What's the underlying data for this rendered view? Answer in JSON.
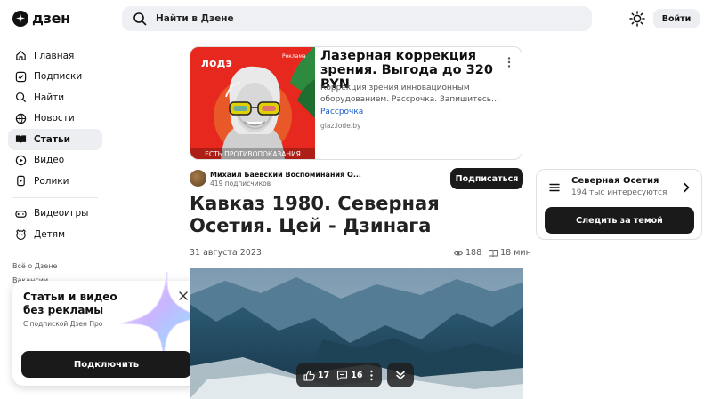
{
  "header": {
    "logo_text": "дзен",
    "search_label": "Найти в Дзене",
    "login_label": "Войти"
  },
  "sidebar": {
    "items": [
      {
        "label": "Главная",
        "icon": "home-icon"
      },
      {
        "label": "Подписки",
        "icon": "subscriptions-icon"
      },
      {
        "label": "Найти",
        "icon": "search-icon"
      },
      {
        "label": "Новости",
        "icon": "news-icon"
      },
      {
        "label": "Статьи",
        "icon": "articles-icon",
        "active": true
      },
      {
        "label": "Видео",
        "icon": "video-icon"
      },
      {
        "label": "Ролики",
        "icon": "clips-icon"
      }
    ],
    "extra_items": [
      {
        "label": "Видеоигры",
        "icon": "gamepad-icon"
      },
      {
        "label": "Детям",
        "icon": "kids-icon"
      }
    ],
    "footer_links": [
      "Всё о Дзене",
      "Вакансии"
    ]
  },
  "promo": {
    "title": "Статьи и видео без рекламы",
    "subtitle": "С подпиской Дзен Про",
    "button_label": "Подключить"
  },
  "ad": {
    "brand": "лодэ",
    "tag": "Реклама",
    "image_caption": "ЕСТЬ ПРОТИВОПОКАЗАНИЯ",
    "title": "Лазерная коррекция зрения. Выгода до 320 BYN",
    "description": "Коррекция зрения инновационным оборудованием. Рассрочка. Запишитесь...",
    "link_label": "Рассрочка",
    "domain": "glaz.lode.by"
  },
  "article": {
    "channel_name": "Михаил Баевский Воспоминания О...",
    "channel_subscribers": "419 подписчиков",
    "subscribe_label": "Подписаться",
    "title": "Кавказ 1980. Северная Осетия. Цей - Дзинага",
    "date": "31 августа 2023",
    "views": "188",
    "read_time": "18 мин",
    "likes": "17",
    "comments": "16"
  },
  "topic_card": {
    "name": "Северная Осетия",
    "interested": "194 тыс интересуются",
    "follow_label": "Следить за темой"
  }
}
